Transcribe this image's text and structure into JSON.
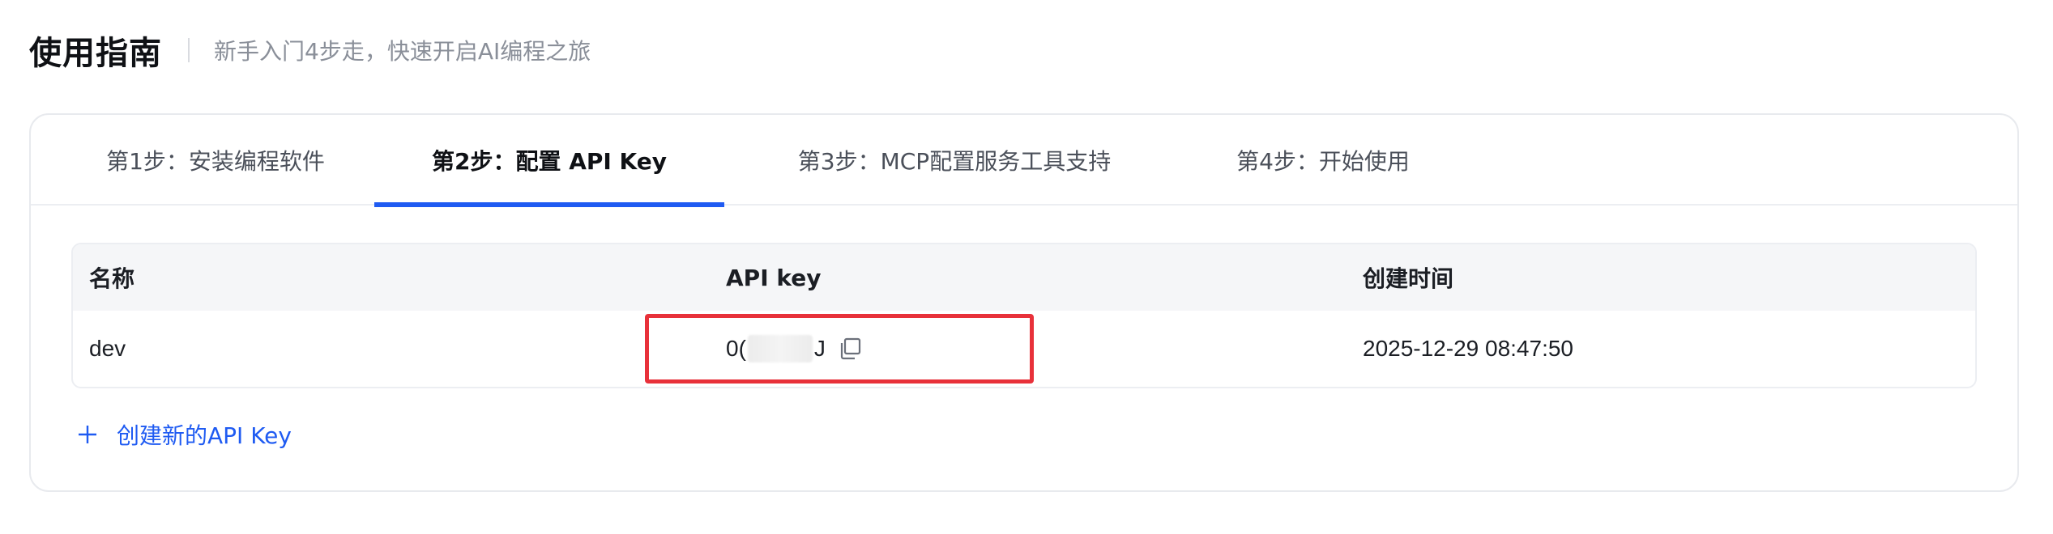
{
  "header": {
    "title": "使用指南",
    "subtitle": "新手入门4步走，快速开启AI编程之旅"
  },
  "tabs": [
    {
      "label": "第1步：安装编程软件",
      "active": false
    },
    {
      "label": "第2步：配置 API Key",
      "active": true
    },
    {
      "label": "第3步：MCP配置服务工具支持",
      "active": false
    },
    {
      "label": "第4步：开始使用",
      "active": false
    }
  ],
  "table": {
    "columns": [
      "名称",
      "API key",
      "创建时间"
    ],
    "rows": [
      {
        "name": "dev",
        "api_key_prefix": "0(",
        "api_key_suffix": "J",
        "created_at": "2025-12-29 08:47:50"
      }
    ]
  },
  "actions": {
    "create_label": "创建新的API Key"
  },
  "colors": {
    "accent": "#1f5bf2",
    "highlight": "#e8313a"
  },
  "icons": {
    "copy": "copy-icon",
    "add": "plus-icon"
  }
}
